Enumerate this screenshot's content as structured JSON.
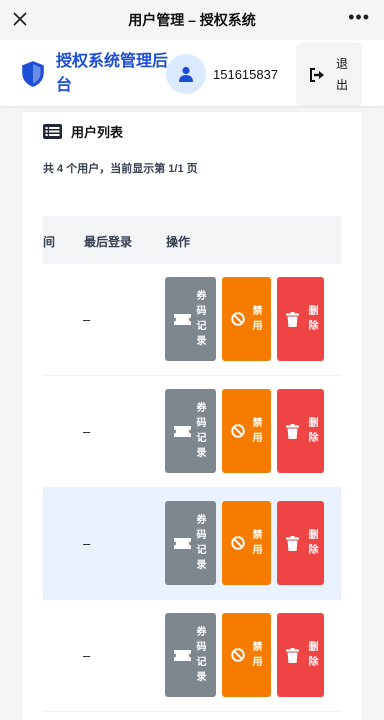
{
  "topbar": {
    "title": "用户管理 – 授权系统"
  },
  "header": {
    "brand": "授权系统管理后台",
    "username": "151615837",
    "logout_label": "退出"
  },
  "card": {
    "title": "用户列表",
    "summary": "共 4 个用户，当前显示第 1/1 页"
  },
  "table": {
    "columns": [
      "间",
      "最后登录",
      "操作"
    ],
    "rows": [
      {
        "last_login": "–",
        "highlighted": false
      },
      {
        "last_login": "–",
        "highlighted": false
      },
      {
        "last_login": "–",
        "highlighted": true
      },
      {
        "last_login": "–",
        "highlighted": false
      }
    ],
    "actions": {
      "codes": "券码记录",
      "disable": "禁用",
      "delete": "删除"
    }
  },
  "colors": {
    "brand": "#1d4ed8",
    "code_btn": "#7e878e",
    "disable_btn": "#f57c00",
    "delete_btn": "#ef4444",
    "highlight_row": "#eaf3fd"
  }
}
